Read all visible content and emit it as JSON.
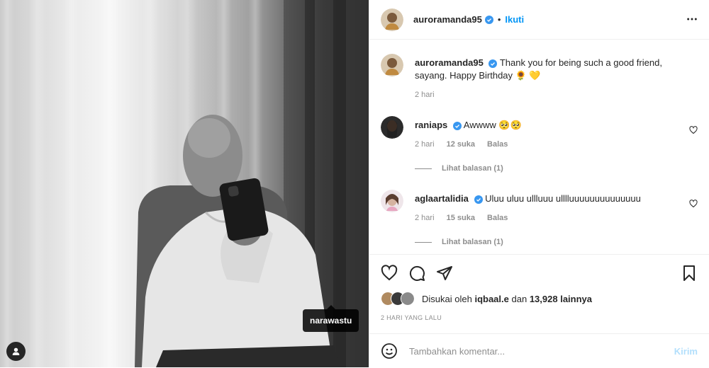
{
  "post": {
    "author": "auroramanda95",
    "follow_label": "Ikuti",
    "separator": "•",
    "tagged_user": "narawastu"
  },
  "comments": [
    {
      "username": "auroramanda95",
      "text": "Thank you for being such a good friend, sayang. Happy Birthday 🌻 💛",
      "time": "2 hari"
    },
    {
      "username": "raniaps",
      "text": "Awwww 🥺🥺",
      "time": "2 hari",
      "likes": "12 suka",
      "reply_label": "Balas",
      "view_replies": "Lihat balasan (1)"
    },
    {
      "username": "aglaartalidia",
      "text": "Uluu uluu ullluuu ulllluuuuuuuuuuuuuu",
      "time": "2 hari",
      "likes": "15 suka",
      "reply_label": "Balas",
      "view_replies": "Lihat balasan (1)"
    }
  ],
  "likes": {
    "prefix": "Disukai oleh",
    "user": "iqbaal.e",
    "joiner": "dan",
    "others": "13,928 lainnya"
  },
  "date": "2 HARI YANG LALU",
  "composer": {
    "placeholder": "Tambahkan komentar...",
    "send_label": "Kirim"
  },
  "colors": {
    "accent": "#0095f6",
    "verified": "#3897f0",
    "send_disabled": "#b2dffc"
  }
}
